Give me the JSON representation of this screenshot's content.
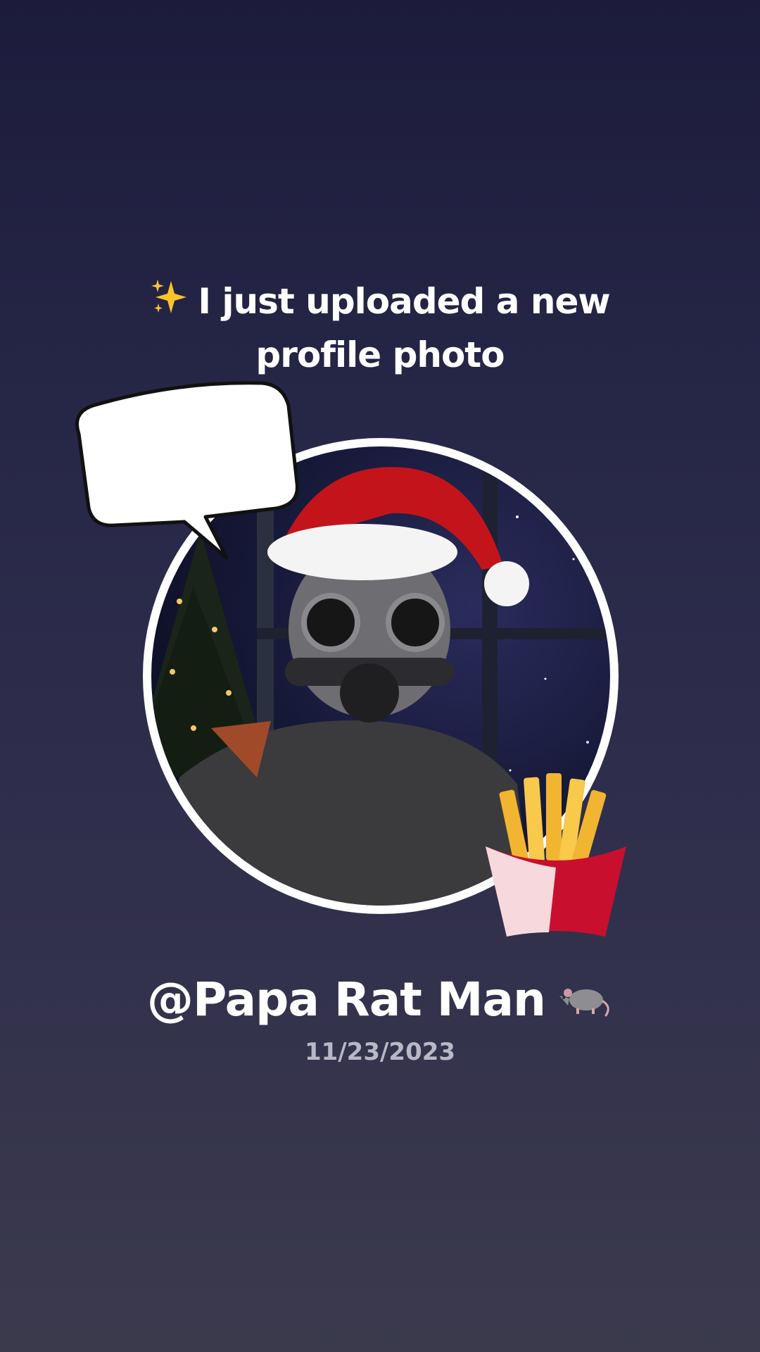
{
  "headline": {
    "line1": "I just uploaded a new",
    "line2": "profile photo",
    "leading_icon": "sparkles-icon"
  },
  "profile": {
    "username": "@Papa Rat Man",
    "username_icon": "rat-icon",
    "date": "11/23/2023"
  },
  "stickers": {
    "speech_bubble": "speech-bubble-sticker",
    "fries": "french-fries-sticker"
  },
  "colors": {
    "background_top": "#1c1b3c",
    "background_bottom": "#3b3a4d",
    "text_primary": "#ffffff",
    "text_secondary": "#b9b8c6",
    "avatar_ring": "#ffffff",
    "santa_hat_red": "#c4141b"
  }
}
